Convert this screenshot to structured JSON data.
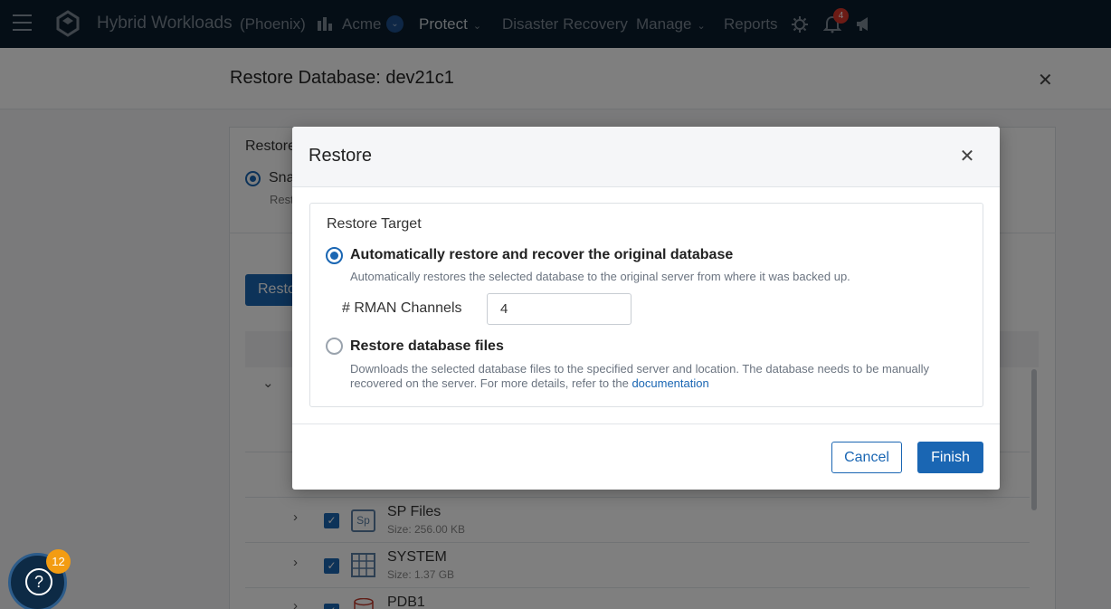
{
  "nav": {
    "product": "Hybrid Workloads",
    "region": "(Phoenix)",
    "tenant": "Acme",
    "items": [
      "Protect",
      "Disaster Recovery",
      "Manage",
      "Reports"
    ],
    "notifications_count": "4"
  },
  "page": {
    "title": "Restore Database: dev21c1",
    "section_label": "Restore",
    "snapshot_option": "Sna",
    "snapshot_desc": "Rest",
    "action_button": "Resto",
    "rows": [
      {
        "name": "SP Files",
        "size": "Size:  256.00 KB",
        "icon": "Sp"
      },
      {
        "name": "SYSTEM",
        "size": "Size:  1.37 GB",
        "icon": "table"
      },
      {
        "name": "PDB1",
        "size": "",
        "icon": "database"
      }
    ]
  },
  "help": {
    "badge_count": "12"
  },
  "modal": {
    "title": "Restore",
    "target_label": "Restore Target",
    "options": [
      {
        "title": "Automatically restore and recover the original database",
        "desc": "Automatically restores the selected database to the original server from where it was backed up.",
        "selected": true
      },
      {
        "title": "Restore database files",
        "desc": "Downloads the selected database files to the specified server and location. The database needs to be manually recovered on the server. For more details, refer to the",
        "link": "documentation",
        "selected": false
      }
    ],
    "rman_label": "# RMAN Channels",
    "rman_value": "4",
    "cancel_label": "Cancel",
    "finish_label": "Finish"
  },
  "colors": {
    "accent": "#1a66b3",
    "nav_bg": "#0b1c2c",
    "badge_orange": "#f39c12",
    "badge_red": "#d9362b"
  }
}
